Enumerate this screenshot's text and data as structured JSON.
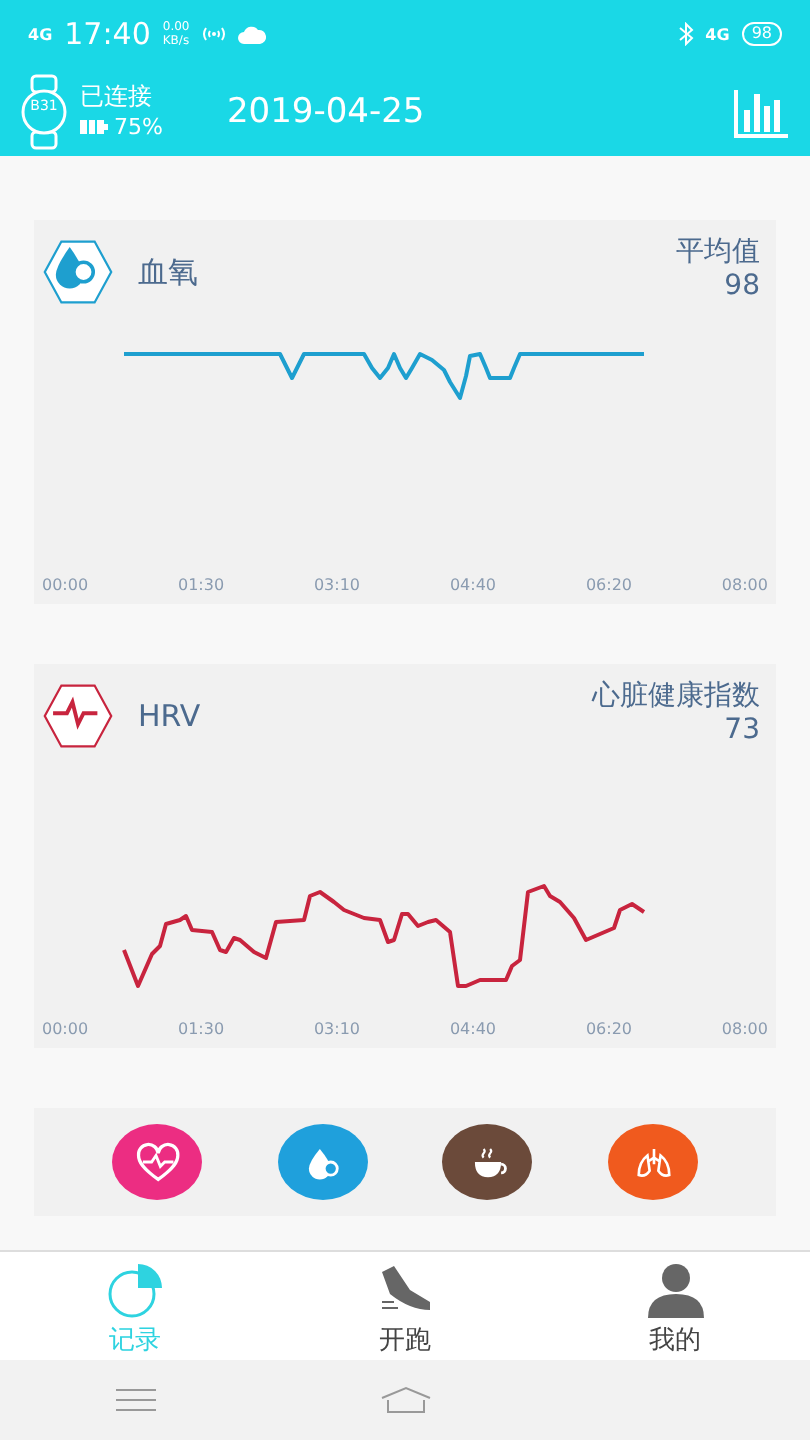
{
  "status_bar": {
    "network_left": "4G",
    "time": "17:40",
    "speed_value": "0.00",
    "speed_unit": "KB/s",
    "network_right": "4G",
    "battery": "98"
  },
  "header": {
    "device_name": "B31",
    "connection": "已连接",
    "device_battery": "75%",
    "date": "2019-04-25"
  },
  "cards": [
    {
      "kind": "spo2",
      "title": "血氧",
      "stat_label": "平均值",
      "stat_value": "98",
      "x_labels": [
        "00:00",
        "01:30",
        "03:10",
        "04:40",
        "06:20",
        "08:00"
      ]
    },
    {
      "kind": "hrv",
      "title": "HRV",
      "stat_label": "心脏健康指数",
      "stat_value": "73",
      "x_labels": [
        "00:00",
        "01:30",
        "03:10",
        "04:40",
        "06:20",
        "08:00"
      ]
    }
  ],
  "shortcuts": [
    {
      "kind": "heart",
      "color": "#ec2d82"
    },
    {
      "kind": "oxygen",
      "color": "#1fa0dc"
    },
    {
      "kind": "coffee",
      "color": "#6b4a3a"
    },
    {
      "kind": "lungs",
      "color": "#f05a1e"
    }
  ],
  "tabs": [
    {
      "kind": "record",
      "label": "记录",
      "selected": true
    },
    {
      "kind": "run",
      "label": "开跑",
      "selected": false
    },
    {
      "kind": "me",
      "label": "我的",
      "selected": false
    }
  ]
}
